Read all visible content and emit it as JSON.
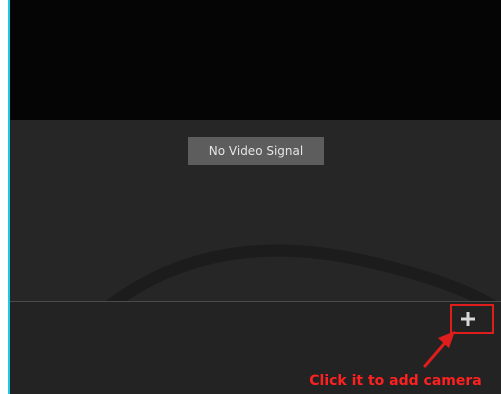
{
  "video": {
    "status_text": "No Video Signal"
  },
  "toolbar": {
    "add_camera_icon": "plus-icon"
  },
  "annotation": {
    "callout_text": "Click it to add camera"
  },
  "colors": {
    "accent": "#1ec8e6",
    "annotation": "#e01d1d"
  }
}
